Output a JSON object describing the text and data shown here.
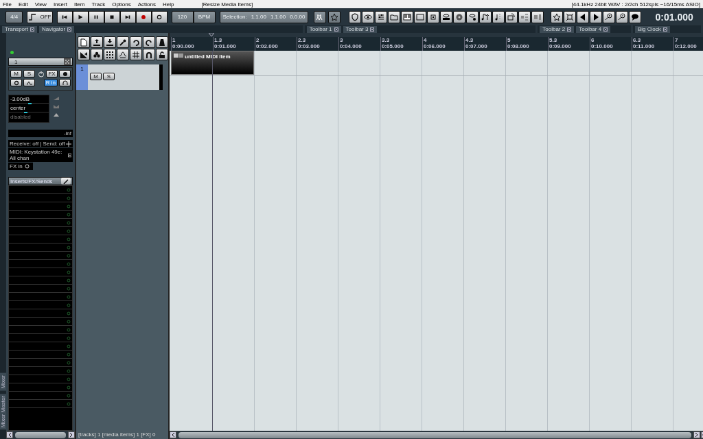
{
  "menu": [
    "File",
    "Edit",
    "View",
    "Insert",
    "Item",
    "Track",
    "Options",
    "Actions",
    "Help"
  ],
  "action_hint": "[Resize Media Items]",
  "audio_status": "[44.1kHz 24bit WAV : 2/2ch 512spls ~16/15ms ASIO]",
  "transport": {
    "time_signature": "4/4",
    "automation_mode": "OFF",
    "tempo": "120",
    "tempo_unit": "BPM",
    "selection_label": "Selection:",
    "selection_start": "1.1.00",
    "selection_end": "1.1.00",
    "selection_length": "0.0.00",
    "record_armed": false,
    "repeat": false
  },
  "big_clock": "0:01.000",
  "dock_groups": [
    {
      "tabs": [
        {
          "label": "Transport"
        },
        {
          "label": "Navigator"
        }
      ]
    },
    {
      "tabs": [
        {
          "label": "Toolbar 1"
        },
        {
          "label": "Toolbar 3"
        }
      ]
    },
    {
      "tabs": [
        {
          "label": "Toolbar 2"
        },
        {
          "label": "Toolbar 4"
        }
      ]
    },
    {
      "tabs": [
        {
          "label": "Big Clock"
        }
      ]
    }
  ],
  "mixer_strip": {
    "track_number": "1",
    "mute_label": "M",
    "solo_label": "S",
    "fx_label": "FX",
    "input_label": "R in",
    "volume": "-3.00dB",
    "volume_fader": {
      "level": 0.52
    },
    "pan": "center",
    "pan_slider": {
      "level": 0.42
    },
    "width": "disabled",
    "width_disabled": true,
    "meter": "-inf",
    "routing": "Receive: off | Send: off",
    "midi_input": "MIDI: Keystation 49e: All chan",
    "fx_in": "FX in",
    "inserts_header": "Inserts/FX/Sends",
    "muted": false,
    "soloed": false,
    "input_monitor": true
  },
  "mixer_tabs": [
    {
      "label": "Mixer"
    },
    {
      "label": "Mixer Master"
    }
  ],
  "tracks": [
    {
      "number": "1",
      "mute_label": "M",
      "solo_label": "S",
      "selected": true,
      "muted": false,
      "soloed": false
    }
  ],
  "ruler": [
    {
      "bar": "1",
      "time": "0:00.000"
    },
    {
      "bar": "1.3",
      "time": "0:01.000"
    },
    {
      "bar": "2",
      "time": "0:02.000"
    },
    {
      "bar": "2.3",
      "time": "0:03.000"
    },
    {
      "bar": "3",
      "time": "0:04.000"
    },
    {
      "bar": "3.3",
      "time": "0:05.000"
    },
    {
      "bar": "4",
      "time": "0:06.000"
    },
    {
      "bar": "4.3",
      "time": "0:07.000"
    },
    {
      "bar": "5",
      "time": "0:08.000"
    },
    {
      "bar": "5.3",
      "time": "0:09.000"
    },
    {
      "bar": "6",
      "time": "0:10.000"
    },
    {
      "bar": "6.3",
      "time": "0:11.000"
    },
    {
      "bar": "7",
      "time": "0:12.000"
    }
  ],
  "items": [
    {
      "name": "untitled MIDI item",
      "selected": false
    }
  ],
  "status_bar": "[tracks] 1 [media items] 1 [FX] 0"
}
